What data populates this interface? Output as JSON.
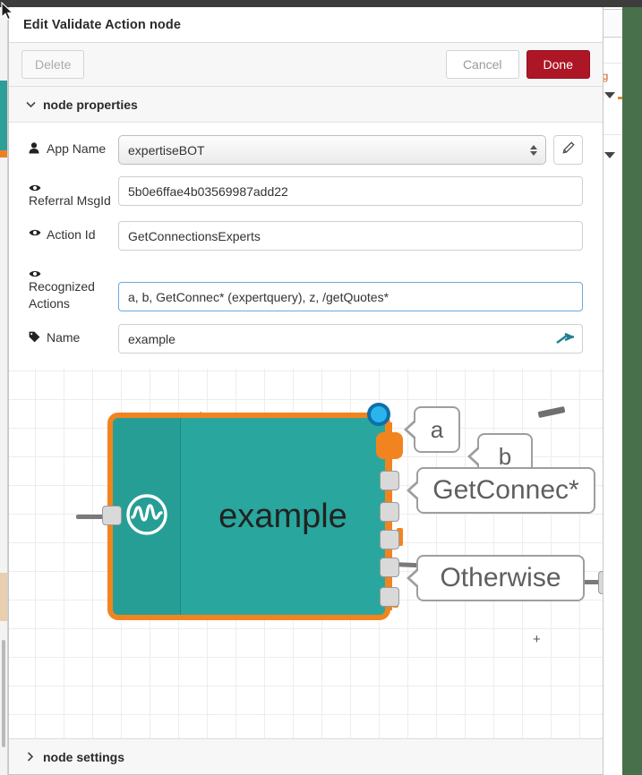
{
  "dialog": {
    "title": "Edit Validate Action node",
    "toolbar": {
      "delete_label": "Delete",
      "cancel_label": "Cancel",
      "done_label": "Done"
    },
    "sections": {
      "properties_label": "node properties",
      "properties_chevron": "⌄",
      "settings_label": "node settings",
      "settings_chevron": "›"
    },
    "fields": [
      {
        "label": "App Name",
        "icon": "user-icon",
        "type": "select",
        "value": "expertiseBOT",
        "has_edit_button": true,
        "edit_icon": "pencil-icon"
      },
      {
        "label": "Referral MsgId",
        "icon": "eye-icon",
        "type": "text",
        "value": "5b0e6ffae4b03569987add22",
        "focused": false
      },
      {
        "label": "Action Id",
        "icon": "eye-icon",
        "type": "text",
        "value": "GetConnectionsExperts",
        "focused": false
      },
      {
        "label": "Recognized Actions",
        "icon": "eye-icon",
        "type": "text",
        "value": "a, b, GetConnec* (expertquery), z, /getQuotes*",
        "focused": true
      },
      {
        "label": "Name",
        "icon": "tag-icon",
        "type": "text",
        "value": "example",
        "inline_icon": "node-red-icon",
        "focused": false
      }
    ]
  },
  "canvas": {
    "node": {
      "label": "example",
      "icon": "waveform-circle-icon",
      "body_color": "#29a79e",
      "selection_color": "#f2841f",
      "input_port_count": 1,
      "output_port_count": 6
    },
    "output_labels": [
      {
        "text": "a"
      },
      {
        "text": "b"
      },
      {
        "text": "GetConnec*"
      },
      {
        "text": "Otherwise"
      }
    ],
    "plus_marks": [
      "+",
      "+"
    ],
    "grid": "on"
  },
  "background": {
    "right_panel_text": "nsg",
    "right_strip_color": "#47704b"
  }
}
